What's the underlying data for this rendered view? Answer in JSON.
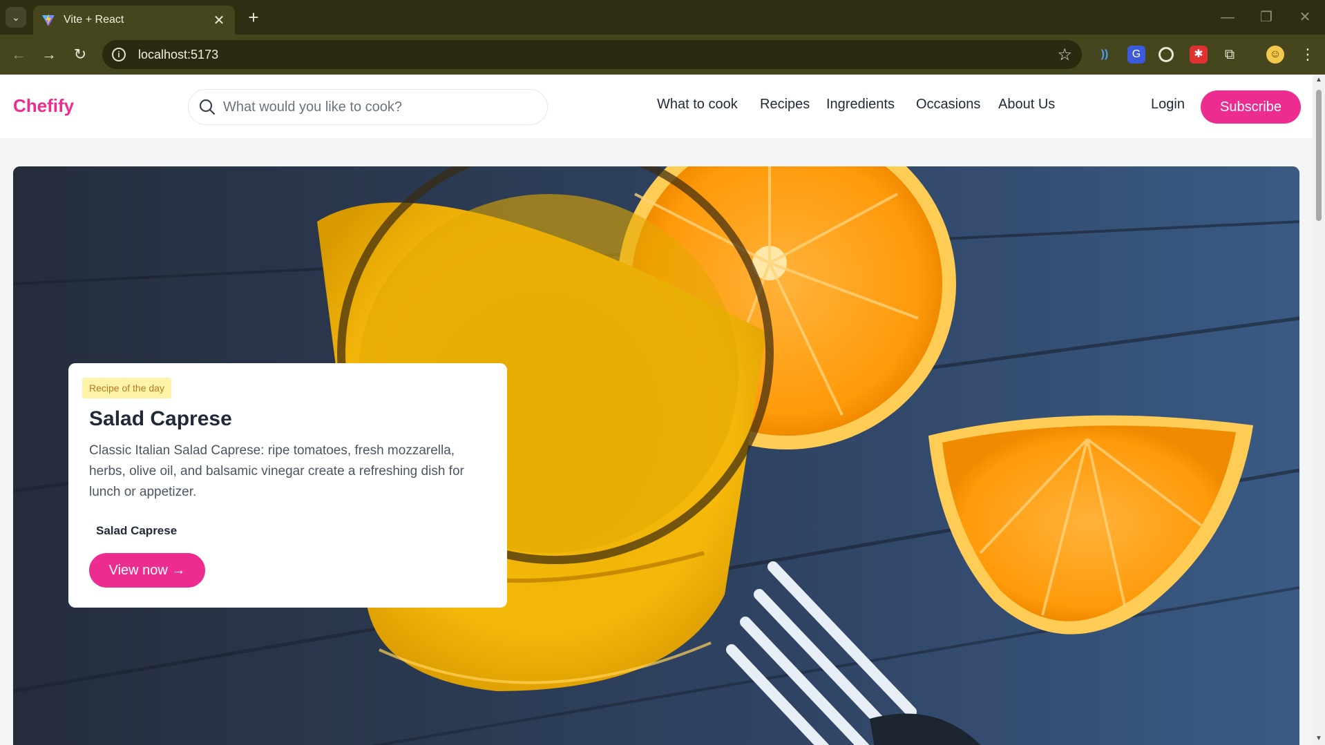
{
  "browser": {
    "tab_title": "Vite + React",
    "url": "localhost:5173",
    "tab_search_icon": "chevron-down-icon",
    "new_tab_label": "+",
    "tab_close_label": "✕",
    "back_label": "←",
    "forward_label": "→",
    "reload_label": "↻",
    "star_label": "☆",
    "menu_label": "⋮",
    "minimize_label": "—",
    "restore_label": "❐",
    "close_label": "✕",
    "extensions": [
      "audio-extension-icon",
      "translate-extension-icon",
      "target-extension-icon",
      "bug-extension-icon",
      "puzzle-extensions-icon",
      "profile-avatar-icon"
    ],
    "colors": {
      "frame": "#2e2e12",
      "toolbar": "#45451e",
      "omnibox": "#2a2a10"
    }
  },
  "site": {
    "logo": "Chefify",
    "search": {
      "placeholder": "What would you like to cook?"
    },
    "nav": [
      "What to cook",
      "Recipes",
      "Ingredients",
      "Occasions",
      "About Us"
    ],
    "login_label": "Login",
    "subscribe_label": "Subscribe",
    "accent_color": "#ec2d8f"
  },
  "hero": {
    "image_subject": "orange-juice-glass-and-orange-halves",
    "card": {
      "badge": "Recipe of the day",
      "title": "Salad Caprese",
      "description": "Classic Italian Salad Caprese: ripe tomatoes, fresh mozzarella, herbs, olive oil, and balsamic vinegar create a refreshing dish for lunch or appetizer.",
      "recipe_name": "Salad Caprese",
      "cta_label": "View now →"
    }
  }
}
